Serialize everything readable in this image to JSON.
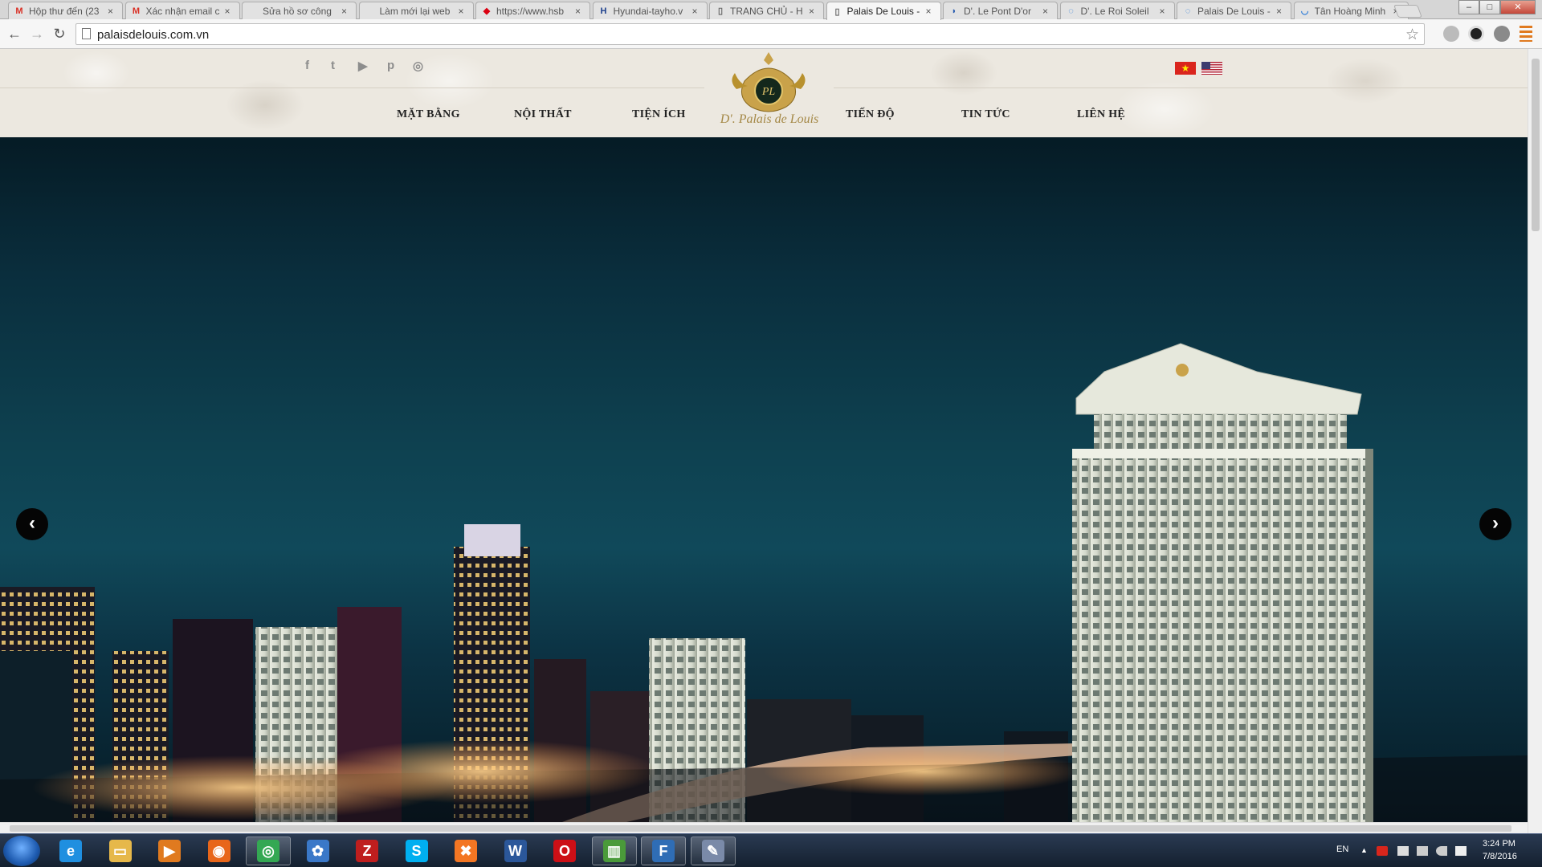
{
  "browser": {
    "tabs": [
      {
        "title": "Hộp thư đến (23",
        "favicon": "gmail-icon",
        "color": "#d93025",
        "glyph": "M",
        "active": false
      },
      {
        "title": "Xác nhận email c",
        "favicon": "gmail-icon",
        "color": "#d93025",
        "glyph": "M",
        "active": false
      },
      {
        "title": "Sửa hồ sơ công",
        "favicon": "blank-icon",
        "color": "#888888",
        "glyph": "",
        "active": false
      },
      {
        "title": "Làm mới lại web",
        "favicon": "blank-icon",
        "color": "#888888",
        "glyph": "",
        "active": false
      },
      {
        "title": "https://www.hsb",
        "favicon": "hsbc-icon",
        "color": "#db0011",
        "glyph": "◆",
        "active": false
      },
      {
        "title": "Hyundai-tayho.v",
        "favicon": "hyundai-icon",
        "color": "#1b3f8c",
        "glyph": "H",
        "active": false
      },
      {
        "title": "TRANG CHỦ - H",
        "favicon": "page-icon",
        "color": "#666666",
        "glyph": "▯",
        "active": false
      },
      {
        "title": "Palais De Louis -",
        "favicon": "page-icon",
        "color": "#666666",
        "glyph": "▯",
        "active": true
      },
      {
        "title": "D'. Le Pont D'or",
        "favicon": "site-icon",
        "color": "#2a5db0",
        "glyph": "◗",
        "active": false
      },
      {
        "title": "D'. Le Roi Soleil",
        "favicon": "loading-icon",
        "color": "#2a7ad8",
        "glyph": "◌",
        "active": false
      },
      {
        "title": "Palais De Louis -",
        "favicon": "loading-icon",
        "color": "#2a7ad8",
        "glyph": "◌",
        "active": false
      },
      {
        "title": "Tân Hoàng Minh",
        "favicon": "loading-icon",
        "color": "#2a7ad8",
        "glyph": "◡",
        "active": false
      }
    ],
    "tab_close": "×",
    "url": "palaisdelouis.com.vn",
    "back": "←",
    "forward": "→",
    "reload": "↻",
    "star": "☆",
    "window_minimize": "–",
    "window_maximize": "□",
    "window_close": "✕"
  },
  "site": {
    "social": [
      {
        "name": "facebook-icon",
        "glyph": "f"
      },
      {
        "name": "twitter-icon",
        "glyph": "t"
      },
      {
        "name": "youtube-icon",
        "glyph": "▶"
      },
      {
        "name": "pinterest-icon",
        "glyph": "p"
      },
      {
        "name": "instagram-icon",
        "glyph": "◎"
      }
    ],
    "menu_left": [
      "MẶT BẰNG",
      "NỘI THẤT",
      "TIỆN ÍCH"
    ],
    "menu_right": [
      "TIẾN ĐỘ",
      "TIN TỨC",
      "LIÊN HỆ"
    ],
    "logo_monogram": "PL",
    "logo_script": "D'. Palais de Louis",
    "flag_vn_star": "★",
    "slider_prev": "‹",
    "slider_next": "›"
  },
  "taskbar": {
    "apps": [
      {
        "name": "internet-explorer-icon",
        "glyph": "e",
        "color": "#1f8fe0",
        "pinned": false
      },
      {
        "name": "file-explorer-icon",
        "glyph": "▭",
        "color": "#e6b84a",
        "pinned": false
      },
      {
        "name": "media-player-icon",
        "glyph": "▶",
        "color": "#e07a1f",
        "pinned": false
      },
      {
        "name": "firefox-icon",
        "glyph": "◉",
        "color": "#e8661a",
        "pinned": false
      },
      {
        "name": "chrome-icon",
        "glyph": "◎",
        "color": "#34a853",
        "pinned": true
      },
      {
        "name": "app-tree-icon",
        "glyph": "✿",
        "color": "#3a78c8",
        "pinned": false
      },
      {
        "name": "filezilla-icon",
        "glyph": "Z",
        "color": "#bf1e1e",
        "pinned": false
      },
      {
        "name": "skype-icon",
        "glyph": "S",
        "color": "#00aff0",
        "pinned": false
      },
      {
        "name": "xampp-icon",
        "glyph": "✖",
        "color": "#f37623",
        "pinned": false
      },
      {
        "name": "word-icon",
        "glyph": "W",
        "color": "#2b579a",
        "pinned": false
      },
      {
        "name": "opera-icon",
        "glyph": "O",
        "color": "#cc0f16",
        "pinned": false
      },
      {
        "name": "chart-app-icon",
        "glyph": "▥",
        "color": "#4a9a3a",
        "pinned": true
      },
      {
        "name": "foxit-icon",
        "glyph": "F",
        "color": "#2f6db5",
        "pinned": true
      },
      {
        "name": "tool-app-icon",
        "glyph": "✎",
        "color": "#7a8aa8",
        "pinned": true
      }
    ],
    "lang": "EN",
    "time": "3:24 PM",
    "date": "7/8/2016",
    "tray_arrow": "▲"
  }
}
